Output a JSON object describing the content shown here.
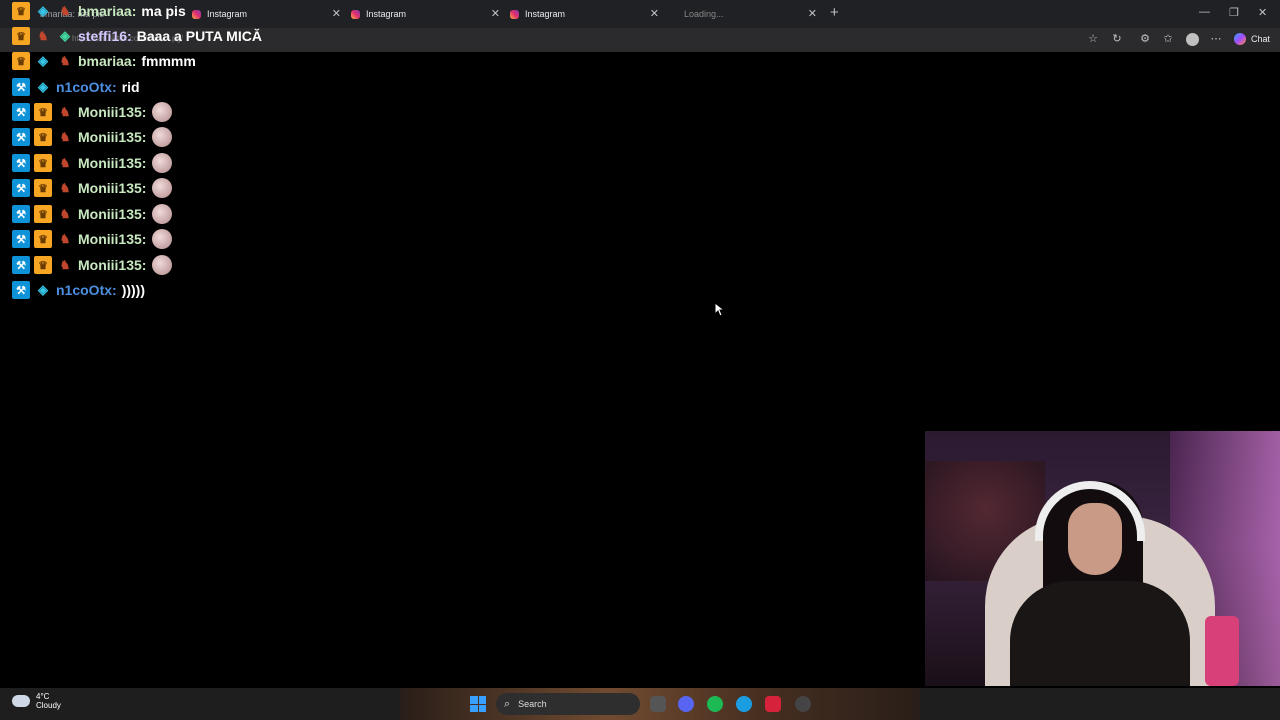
{
  "browser": {
    "tabs": [
      {
        "label": "bmariaa: ma pis",
        "state": "active"
      },
      {
        "label": "Instagram"
      },
      {
        "label": "Instagram"
      },
      {
        "label": "Instagram"
      },
      {
        "label": "Loading..."
      }
    ],
    "url": "https://vm.tiktok.com/ZMrJ...pg/",
    "chat_button": "Chat"
  },
  "chat": {
    "messages": [
      {
        "user": "bmariaa",
        "text": "ma pis",
        "badges": [
          "crown-icon",
          "gift-icon",
          "headphones-icon"
        ],
        "color": "green"
      },
      {
        "user": "steffi16",
        "text": "Baaa a PUTA MICĂ",
        "badges": [
          "crown-icon",
          "headphones-icon",
          "gift-icon"
        ],
        "color": "lavender"
      },
      {
        "user": "bmariaa",
        "text": "fmmmm",
        "badges": [
          "crown-icon",
          "gift-icon",
          "headphones-icon"
        ],
        "color": "green"
      },
      {
        "user": "n1coOtx",
        "text": "rid",
        "badges": [
          "mod-icon",
          "gift-icon"
        ],
        "color": "blue"
      },
      {
        "user": "Moniii135",
        "text": "",
        "emote": true,
        "badges": [
          "mod-icon",
          "crown-icon",
          "headphones-icon"
        ],
        "color": "green"
      },
      {
        "user": "Moniii135",
        "text": "",
        "emote": true,
        "badges": [
          "mod-icon",
          "crown-icon",
          "headphones-icon"
        ],
        "color": "green"
      },
      {
        "user": "Moniii135",
        "text": "",
        "emote": true,
        "badges": [
          "mod-icon",
          "crown-icon",
          "headphones-icon"
        ],
        "color": "green"
      },
      {
        "user": "Moniii135",
        "text": "",
        "emote": true,
        "badges": [
          "mod-icon",
          "crown-icon",
          "headphones-icon"
        ],
        "color": "green"
      },
      {
        "user": "Moniii135",
        "text": "",
        "emote": true,
        "badges": [
          "mod-icon",
          "crown-icon",
          "headphones-icon"
        ],
        "color": "green"
      },
      {
        "user": "Moniii135",
        "text": "",
        "emote": true,
        "badges": [
          "mod-icon",
          "crown-icon",
          "headphones-icon"
        ],
        "color": "green"
      },
      {
        "user": "Moniii135",
        "text": "",
        "emote": true,
        "badges": [
          "mod-icon",
          "crown-icon",
          "headphones-icon"
        ],
        "color": "green"
      },
      {
        "user": "n1coOtx",
        "text": ")))))",
        "badges": [
          "mod-icon",
          "gift-icon"
        ],
        "color": "blue"
      }
    ]
  },
  "taskbar": {
    "weather_temp": "4°C",
    "weather_desc": "Cloudy",
    "search_label": "Search"
  },
  "colors": {
    "mod_badge": "#0e92d8",
    "crown_badge": "#f6a623",
    "user_green": "#c8e8c0",
    "user_blue": "#4d8fe0"
  }
}
